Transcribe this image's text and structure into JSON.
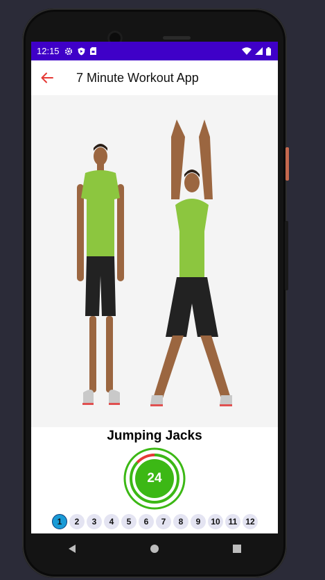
{
  "status": {
    "time": "12:15",
    "settings_icon": "gear-icon",
    "shield_icon": "shield-icon",
    "sim_icon": "sim-icon"
  },
  "appbar": {
    "title": "7 Minute Workout App",
    "back_icon": "arrow-back-icon"
  },
  "exercise": {
    "name": "Jumping Jacks",
    "timer_value": "24",
    "timer_progress": 0.87
  },
  "progress": {
    "steps": [
      "1",
      "2",
      "3",
      "4",
      "5",
      "6",
      "7",
      "8",
      "9",
      "10",
      "11",
      "12"
    ],
    "current": "1"
  },
  "colors": {
    "statusbar": "#3f00c8",
    "accent": "#e53935",
    "timer_green": "#3cb815",
    "step_active": "#1a9bd6",
    "step_inactive": "#e4e4f2",
    "shirt": "#8cc63f"
  }
}
